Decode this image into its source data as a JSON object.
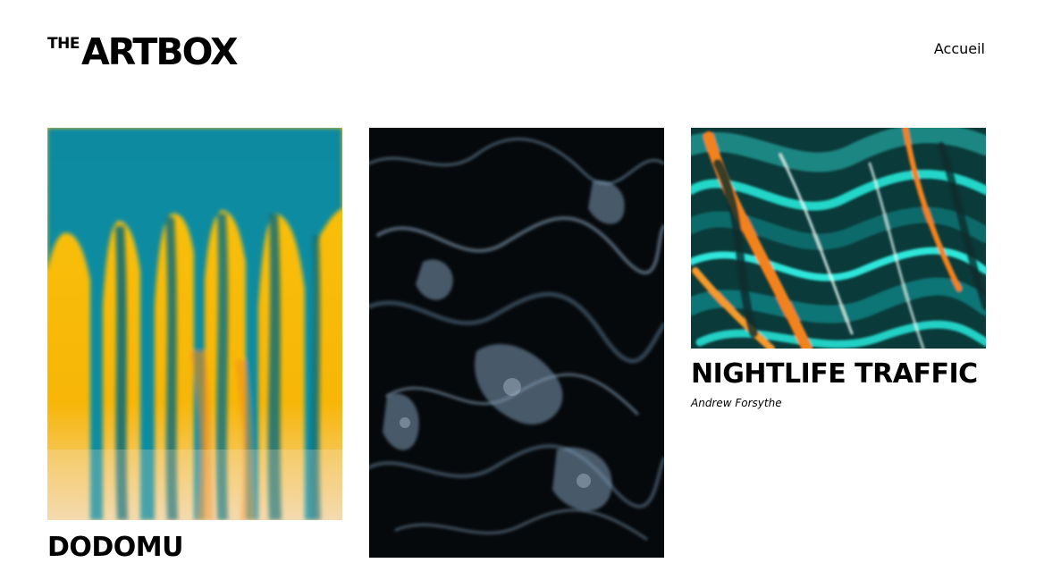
{
  "header": {
    "logo_small": "THE",
    "logo_main": "ARTBOX",
    "nav_link": "Accueil"
  },
  "artworks": [
    {
      "title": "DODOMU",
      "artist": "",
      "image": "yellow-teal-drip-abstract"
    },
    {
      "title": "",
      "artist": "",
      "image": "dark-blue-marble-abstract"
    },
    {
      "title": "NIGHTLIFE TRAFFIC",
      "artist": "Andrew Forsythe",
      "image": "teal-orange-fluid-abstract"
    }
  ],
  "colors": {
    "background": "#ffffff",
    "text": "#000000",
    "teal": "#0a8aa0",
    "yellow": "#f8bf0a",
    "dark": "#05090c",
    "cyan": "#20d6c8",
    "orange": "#f4821c"
  }
}
